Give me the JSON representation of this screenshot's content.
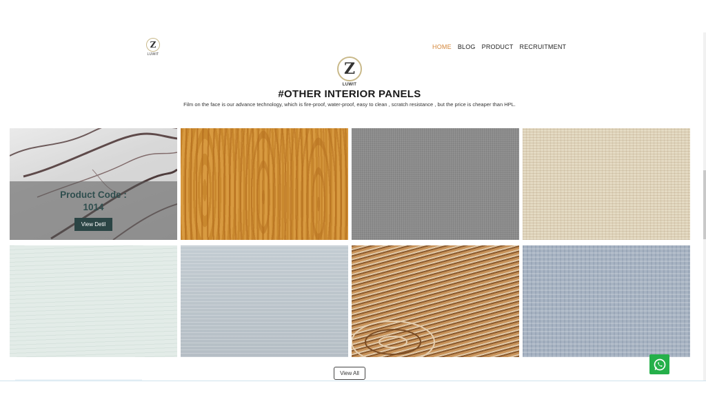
{
  "header": {
    "logo_letter": "Z",
    "logo_name": "LUWIT",
    "nav": [
      "HOME",
      "BLOG",
      "PRODUCT",
      "RECRUITMENT"
    ]
  },
  "section": {
    "logo_letter": "Z",
    "logo_name": "LUWIT",
    "title": "#OTHER INTERIOR PANELS",
    "subtitle": "Film on the face is our advance technology, which is fire-proof, water-proof, easy to clean , scratch resistance , but the price is cheaper than HPL."
  },
  "featured": {
    "code_line1": "Product Code :",
    "code_line2": "1014",
    "button": "View Detil"
  },
  "products": [
    {
      "finish": "white marble"
    },
    {
      "finish": "golden oak wood"
    },
    {
      "finish": "grey fabric"
    },
    {
      "finish": "beige linen"
    },
    {
      "finish": "mint white wood"
    },
    {
      "finish": "blue-grey wood"
    },
    {
      "finish": "brushed ash wood"
    },
    {
      "finish": "silver weave"
    }
  ],
  "view_all": "View All",
  "colors": {
    "accent": "#d4873a",
    "button": "#2b4545",
    "whatsapp": "#25b04a"
  }
}
